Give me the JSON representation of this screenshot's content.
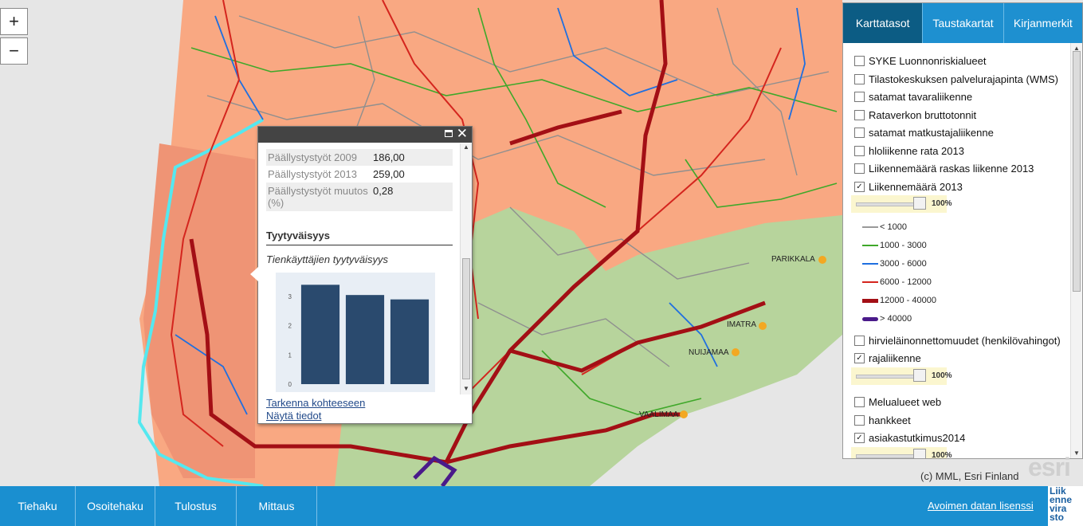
{
  "map": {
    "zoom_in_label": "+",
    "zoom_out_label": "−",
    "place_labels": [
      "PARIKKALA",
      "IMATRA",
      "NUIJAMAA",
      "VAALIMAA"
    ],
    "colors": {
      "area_orange": "#f9a882",
      "area_green": "#b7d49c",
      "sea": "#e3e3e3",
      "coast_cyan": "#55e8ef"
    }
  },
  "popup": {
    "rows": [
      {
        "key": "Päällystystyöt 2009",
        "value": "186,00"
      },
      {
        "key": "Päällystystyöt 2013",
        "value": "259,00"
      },
      {
        "key": "Päällystystyöt muutos (%)",
        "value": "0,28"
      }
    ],
    "section_title": "Tyytyväisyys",
    "chart_caption": "Tienkäyttäjien tyytyväisyys",
    "link_zoom": "Tarkenna kohteeseen",
    "link_details": "Näytä tiedot",
    "max_icon": "maximize-icon",
    "close_icon": "✕"
  },
  "chart_data": {
    "type": "bar",
    "categories": [
      "",
      "",
      ""
    ],
    "values": [
      3.4,
      3.05,
      2.9
    ],
    "ylim": [
      0,
      3.6
    ],
    "yticks": [
      "0",
      "1",
      "2",
      "3"
    ],
    "color": "#2a4a6e"
  },
  "panel": {
    "tabs": [
      "Karttatasot",
      "Taustakartat",
      "Kirjanmerkit"
    ],
    "layers": [
      {
        "label": "SYKE Luonnonriskialueet",
        "checked": false
      },
      {
        "label": "Tilastokeskuksen palvelurajapinta (WMS)",
        "checked": false
      },
      {
        "label": "satamat tavaraliikenne",
        "checked": false
      },
      {
        "label": "Rataverkon bruttotonnit",
        "checked": false
      },
      {
        "label": "satamat matkustajaliikenne",
        "checked": false
      },
      {
        "label": "hloliikenne rata 2013",
        "checked": false
      },
      {
        "label": "Liikennemäärä raskas liikenne 2013",
        "checked": false
      },
      {
        "label": "Liikennemäärä 2013",
        "checked": true
      },
      {
        "label": "hirvieläinonnettomuudet (henkilövahingot)",
        "checked": false
      },
      {
        "label": "rajaliikenne",
        "checked": true
      },
      {
        "label": "Melualueet web",
        "checked": false
      },
      {
        "label": "hankkeet",
        "checked": false
      },
      {
        "label": "asiakastutkimus2014",
        "checked": true
      }
    ],
    "opacity": [
      "100%",
      "100%",
      "100%"
    ],
    "legend": [
      {
        "label": "< 1000",
        "color": "#999999"
      },
      {
        "label": "1000 - 3000",
        "color": "#3fa82a"
      },
      {
        "label": "3000 - 6000",
        "color": "#1f6fe0"
      },
      {
        "label": "6000 - 12000",
        "color": "#d4251e"
      },
      {
        "label": "12000 - 40000",
        "color": "#a30f15"
      },
      {
        "label": "> 40000",
        "color": "#4a1a8a"
      }
    ]
  },
  "copyright": "(c) MML, Esri Finland",
  "esri": "esri",
  "bottombar": {
    "buttons": [
      "Tiehaku",
      "Osoitehaku",
      "Tulostus",
      "Mittaus"
    ],
    "license": "Avoimen datan lisenssi",
    "brand": [
      "Liik",
      "enne",
      "vira",
      "sto"
    ]
  }
}
